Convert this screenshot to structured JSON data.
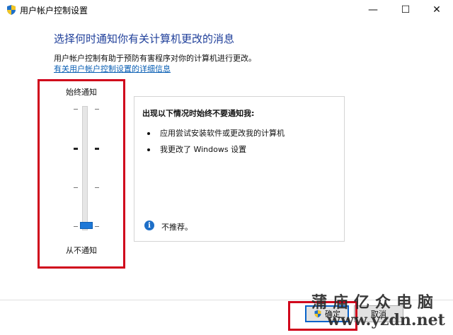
{
  "window": {
    "title": "用户帐户控制设置",
    "controls": {
      "minimize": "—",
      "maximize": "☐",
      "close": "✕"
    }
  },
  "main": {
    "heading": "选择何时通知你有关计算机更改的消息",
    "description": "用户帐户控制有助于预防有害程序对你的计算机进行更改。",
    "more_link": "有关用户帐户控制设置的详细信息"
  },
  "slider": {
    "top_label": "始终通知",
    "bottom_label": "从不通知",
    "levels": 4,
    "selected_level": 1
  },
  "infobox": {
    "title": "出现以下情况时始终不要通知我:",
    "bullets": [
      "应用尝试安装软件或更改我的计算机",
      "我更改了 Windows 设置"
    ],
    "note_icon": "i",
    "note": "不推荐。"
  },
  "footer": {
    "ok_label": "确定",
    "cancel_label": "取消"
  },
  "watermark": {
    "brand": "蒲庙亿众电脑",
    "url": "www.yzdn.net"
  },
  "colors": {
    "heading": "#1f3f9a",
    "link": "#0a5fb4",
    "thumb": "#1e78d7",
    "highlight": "#d0021b"
  }
}
